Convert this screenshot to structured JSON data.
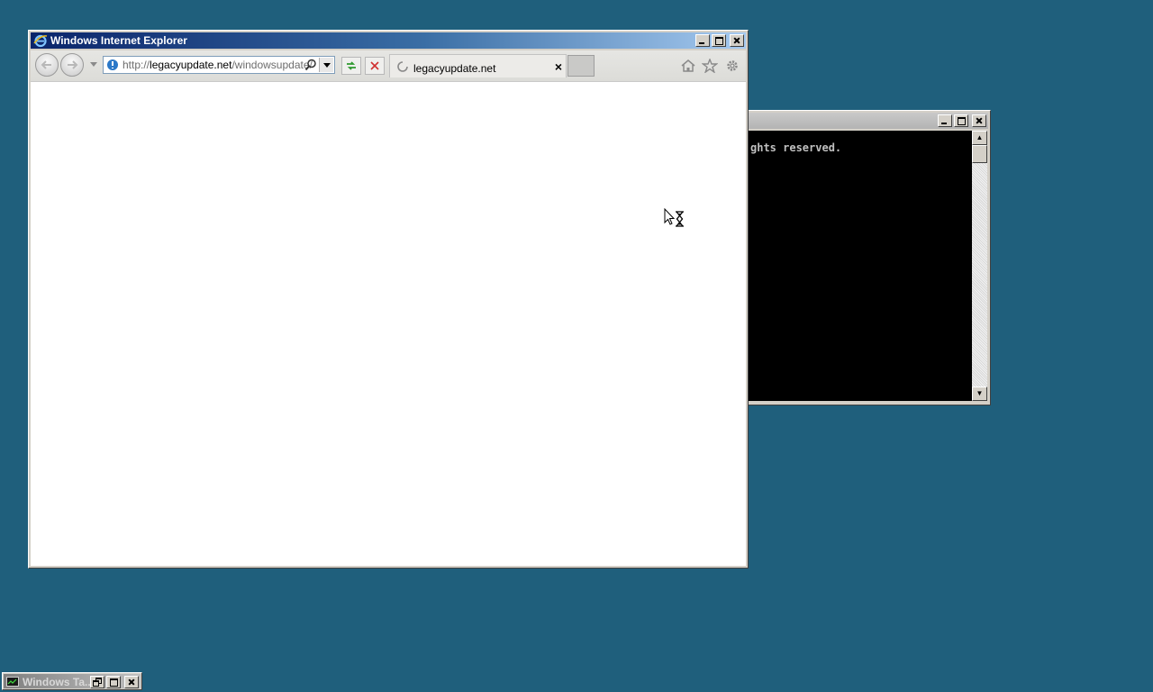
{
  "desktop": {
    "background": "#1f5f7c"
  },
  "console": {
    "visible_text": "ghts reserved.",
    "buttons": [
      "minimize",
      "maximize",
      "close"
    ]
  },
  "ie": {
    "title": "Windows Internet Explorer",
    "address": {
      "url_prefix": "http://",
      "host": "legacyupdate.net",
      "path": "/windowsupdate/"
    },
    "tab": {
      "label": "legacyupdate.net",
      "close_glyph": "×",
      "loading": true
    },
    "icons": [
      "back-icon",
      "forward-icon",
      "globe-icon",
      "search-icon",
      "refresh-icon",
      "stop-icon",
      "home-icon",
      "favorites-star-icon",
      "tools-gear-icon"
    ]
  },
  "taskwin": {
    "title": "Windows Ta..."
  },
  "cursor": {
    "state": "busy"
  }
}
